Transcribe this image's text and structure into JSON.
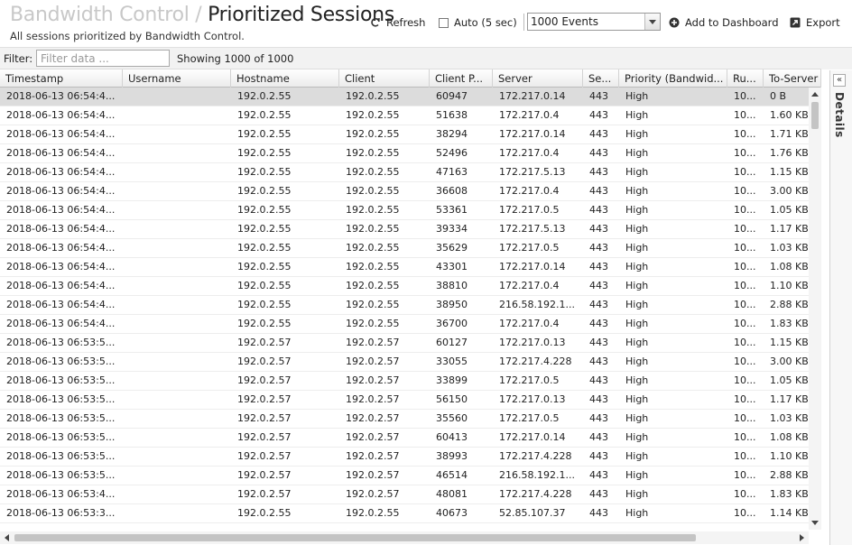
{
  "header": {
    "app_name": "Bandwidth Control",
    "separator": "/",
    "page_title": "Prioritized Sessions",
    "subtitle": "All sessions prioritized by Bandwidth Control."
  },
  "toolbar": {
    "refresh_label": "Refresh",
    "auto_label": "Auto (5 sec)",
    "auto_checked": false,
    "events_selected": "1000 Events",
    "add_dashboard_label": "Add to Dashboard",
    "export_label": "Export"
  },
  "filter": {
    "label": "Filter:",
    "placeholder": "Filter data ...",
    "value": "",
    "showing": "Showing 1000 of 1000"
  },
  "details": {
    "label": "Details",
    "collapse_glyph": "«"
  },
  "table": {
    "columns": [
      "Timestamp",
      "Username",
      "Hostname",
      "Client",
      "Client P...",
      "Server",
      "Se...",
      "Priority (Bandwid...",
      "Ru...",
      "To-Server"
    ],
    "rows": [
      [
        "2018-06-13 06:54:4...",
        "",
        "192.0.2.55",
        "192.0.2.55",
        "60947",
        "172.217.0.14",
        "443",
        "High",
        "10...",
        "0 B"
      ],
      [
        "2018-06-13 06:54:4...",
        "",
        "192.0.2.55",
        "192.0.2.55",
        "51638",
        "172.217.0.4",
        "443",
        "High",
        "10...",
        "1.60 KB"
      ],
      [
        "2018-06-13 06:54:4...",
        "",
        "192.0.2.55",
        "192.0.2.55",
        "38294",
        "172.217.0.14",
        "443",
        "High",
        "10...",
        "1.71 KB"
      ],
      [
        "2018-06-13 06:54:4...",
        "",
        "192.0.2.55",
        "192.0.2.55",
        "52496",
        "172.217.0.4",
        "443",
        "High",
        "10...",
        "1.76 KB"
      ],
      [
        "2018-06-13 06:54:4...",
        "",
        "192.0.2.55",
        "192.0.2.55",
        "47163",
        "172.217.5.13",
        "443",
        "High",
        "10...",
        "1.15 KB"
      ],
      [
        "2018-06-13 06:54:4...",
        "",
        "192.0.2.55",
        "192.0.2.55",
        "36608",
        "172.217.0.4",
        "443",
        "High",
        "10...",
        "3.00 KB"
      ],
      [
        "2018-06-13 06:54:4...",
        "",
        "192.0.2.55",
        "192.0.2.55",
        "53361",
        "172.217.0.5",
        "443",
        "High",
        "10...",
        "1.05 KB"
      ],
      [
        "2018-06-13 06:54:4...",
        "",
        "192.0.2.55",
        "192.0.2.55",
        "39334",
        "172.217.5.13",
        "443",
        "High",
        "10...",
        "1.17 KB"
      ],
      [
        "2018-06-13 06:54:4...",
        "",
        "192.0.2.55",
        "192.0.2.55",
        "35629",
        "172.217.0.5",
        "443",
        "High",
        "10...",
        "1.03 KB"
      ],
      [
        "2018-06-13 06:54:4...",
        "",
        "192.0.2.55",
        "192.0.2.55",
        "43301",
        "172.217.0.14",
        "443",
        "High",
        "10...",
        "1.08 KB"
      ],
      [
        "2018-06-13 06:54:4...",
        "",
        "192.0.2.55",
        "192.0.2.55",
        "38810",
        "172.217.0.4",
        "443",
        "High",
        "10...",
        "1.10 KB"
      ],
      [
        "2018-06-13 06:54:4...",
        "",
        "192.0.2.55",
        "192.0.2.55",
        "38950",
        "216.58.192.1...",
        "443",
        "High",
        "10...",
        "2.88 KB"
      ],
      [
        "2018-06-13 06:54:4...",
        "",
        "192.0.2.55",
        "192.0.2.55",
        "36700",
        "172.217.0.4",
        "443",
        "High",
        "10...",
        "1.83 KB"
      ],
      [
        "2018-06-13 06:53:5...",
        "",
        "192.0.2.57",
        "192.0.2.57",
        "60127",
        "172.217.0.13",
        "443",
        "High",
        "10...",
        "1.15 KB"
      ],
      [
        "2018-06-13 06:53:5...",
        "",
        "192.0.2.57",
        "192.0.2.57",
        "33055",
        "172.217.4.228",
        "443",
        "High",
        "10...",
        "3.00 KB"
      ],
      [
        "2018-06-13 06:53:5...",
        "",
        "192.0.2.57",
        "192.0.2.57",
        "33899",
        "172.217.0.5",
        "443",
        "High",
        "10...",
        "1.05 KB"
      ],
      [
        "2018-06-13 06:53:5...",
        "",
        "192.0.2.57",
        "192.0.2.57",
        "56150",
        "172.217.0.13",
        "443",
        "High",
        "10...",
        "1.17 KB"
      ],
      [
        "2018-06-13 06:53:5...",
        "",
        "192.0.2.57",
        "192.0.2.57",
        "35560",
        "172.217.0.5",
        "443",
        "High",
        "10...",
        "1.03 KB"
      ],
      [
        "2018-06-13 06:53:5...",
        "",
        "192.0.2.57",
        "192.0.2.57",
        "60413",
        "172.217.0.14",
        "443",
        "High",
        "10...",
        "1.08 KB"
      ],
      [
        "2018-06-13 06:53:5...",
        "",
        "192.0.2.57",
        "192.0.2.57",
        "38993",
        "172.217.4.228",
        "443",
        "High",
        "10...",
        "1.10 KB"
      ],
      [
        "2018-06-13 06:53:5...",
        "",
        "192.0.2.57",
        "192.0.2.57",
        "46514",
        "216.58.192.1...",
        "443",
        "High",
        "10...",
        "2.88 KB"
      ],
      [
        "2018-06-13 06:53:4...",
        "",
        "192.0.2.57",
        "192.0.2.57",
        "48081",
        "172.217.4.228",
        "443",
        "High",
        "10...",
        "1.83 KB"
      ],
      [
        "2018-06-13 06:53:3...",
        "",
        "192.0.2.55",
        "192.0.2.55",
        "40673",
        "52.85.107.37",
        "443",
        "High",
        "10...",
        "1.14 KB"
      ]
    ],
    "selected_row": 0
  },
  "icons": {
    "refresh": "refresh-icon",
    "add": "plus-circle-icon",
    "export": "export-icon"
  }
}
